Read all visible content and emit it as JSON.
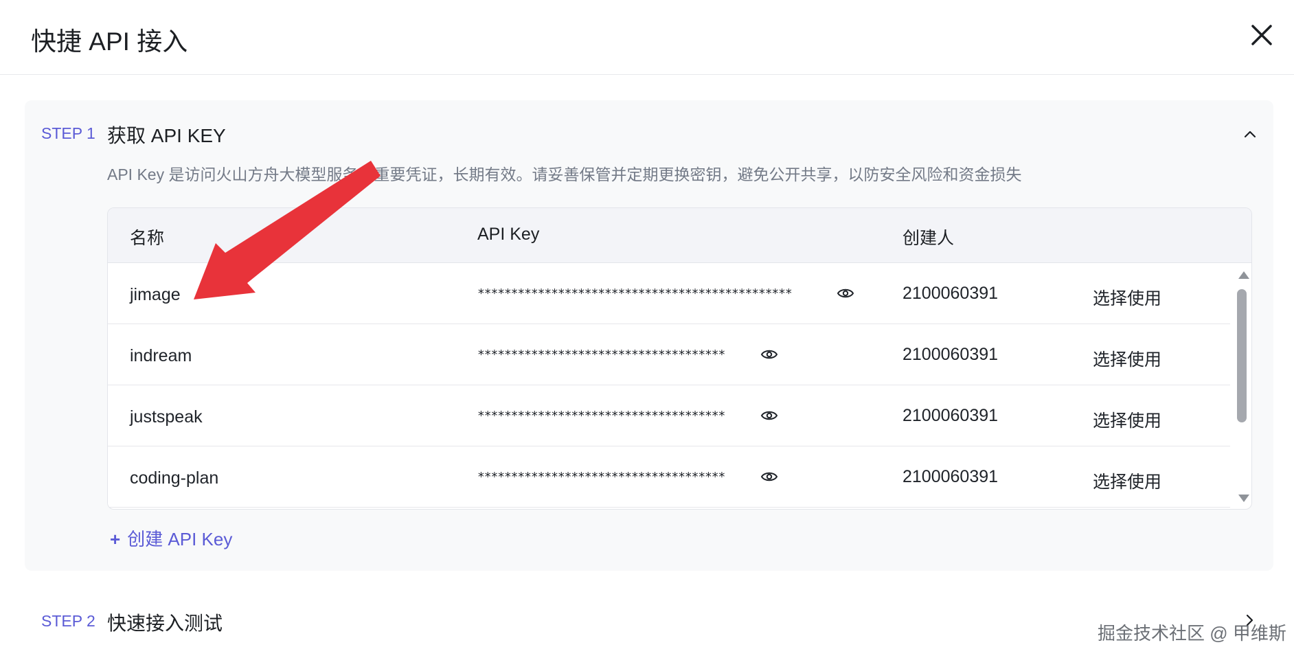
{
  "dialog": {
    "title": "快捷 API 接入"
  },
  "step1": {
    "label": "STEP 1",
    "title": "获取 API KEY",
    "description": "API Key 是访问火山方舟大模型服务的重要凭证，长期有效。请妥善保管并定期更换密钥，避免公开共享，以防安全风险和资金损失"
  },
  "table": {
    "headers": [
      "名称",
      "API Key",
      "创建人"
    ],
    "rows": [
      {
        "name": "jimage",
        "api_key": "***********************************************",
        "creator": "2100060391",
        "action": "选择使用"
      },
      {
        "name": "indream",
        "api_key": "*************************************",
        "creator": "2100060391",
        "action": "选择使用"
      },
      {
        "name": "justspeak",
        "api_key": "*************************************",
        "creator": "2100060391",
        "action": "选择使用"
      },
      {
        "name": "coding-plan",
        "api_key": "*************************************",
        "creator": "2100060391",
        "action": "选择使用"
      }
    ]
  },
  "create_button": {
    "label": "创建 API Key"
  },
  "step2": {
    "label": "STEP 2",
    "title": "快速接入测试"
  },
  "watermark": "掘金技术社区 @ 甲维斯",
  "colors": {
    "accent": "#5b5bd6",
    "annotation_arrow": "#e8333a"
  }
}
